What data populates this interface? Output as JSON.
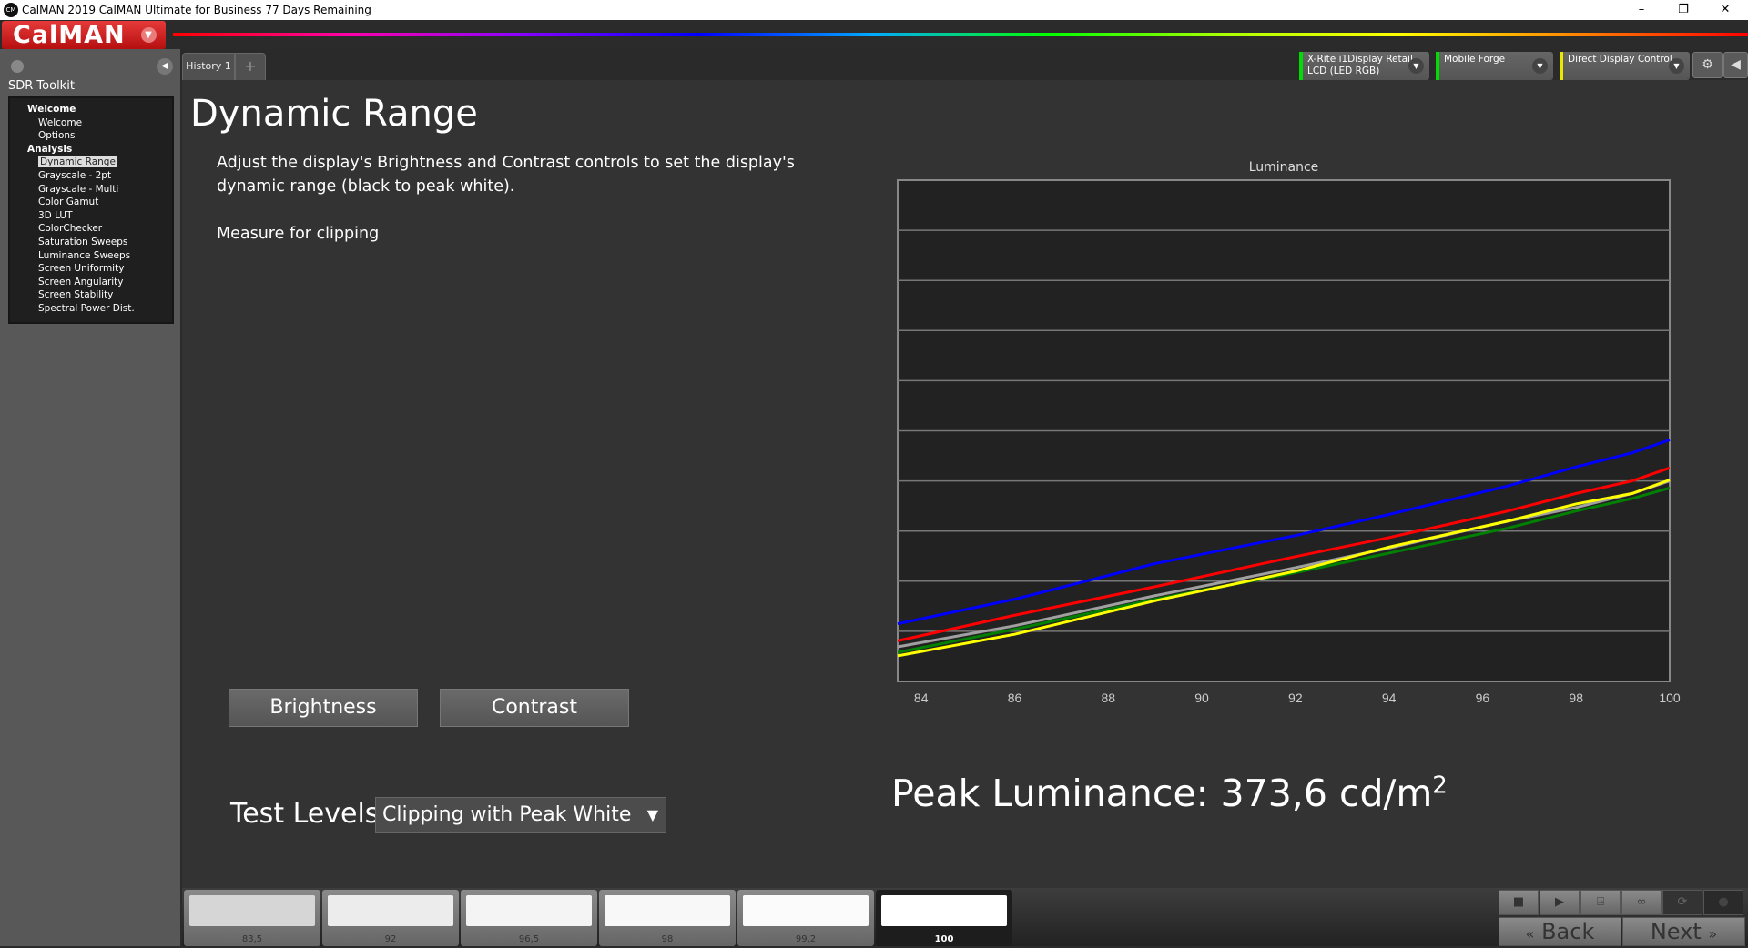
{
  "window": {
    "title": "CalMAN 2019 CalMAN Ultimate for Business 77 Days Remaining",
    "app_icon": "CM",
    "minimize": "–",
    "restore": "❐",
    "close": "✕"
  },
  "logo": "CalMAN",
  "sidebar": {
    "title": "SDR Toolkit",
    "groups": [
      {
        "label": "Welcome",
        "items": [
          "Welcome",
          "Options"
        ]
      },
      {
        "label": "Analysis",
        "items": [
          "Dynamic Range",
          "Grayscale - 2pt",
          "Grayscale - Multi",
          "Color Gamut",
          "3D LUT",
          "ColorChecker",
          "Saturation Sweeps",
          "Luminance Sweeps",
          "Screen Uniformity",
          "Screen Angularity",
          "Screen Stability",
          "Spectral Power Dist."
        ]
      }
    ],
    "selected": "Dynamic Range"
  },
  "tabs": {
    "items": [
      "History 1"
    ],
    "add": "+"
  },
  "devices": [
    {
      "line1": "X-Rite i1Display Retail",
      "line2": "LCD (LED RGB)",
      "color": "#00dd00"
    },
    {
      "line1": "Mobile Forge",
      "line2": "",
      "color": "#00dd00"
    },
    {
      "line1": "Direct Display Control",
      "line2": "",
      "color": "#e8e800"
    }
  ],
  "page": {
    "title": "Dynamic Range",
    "description": "Adjust the display's Brightness and Contrast controls to set the display's dynamic range (black to peak white).",
    "measure": "Measure for clipping",
    "brightness_label": "Brightness",
    "contrast_label": "Contrast",
    "test_levels_label": "Test Levels:",
    "test_levels_value": "Clipping with Peak White",
    "peak_label": "Peak Luminance: 373,6  cd/m",
    "peak_sup": "2"
  },
  "chart_data": {
    "type": "line",
    "title": "Luminance",
    "xlabel": "",
    "ylabel": "",
    "xlim": [
      83.5,
      100
    ],
    "ylim": [
      0,
      10
    ],
    "xticks": [
      "84",
      "86",
      "88",
      "90",
      "92",
      "94",
      "96",
      "98",
      "100"
    ],
    "grid": true,
    "x": [
      83.5,
      86,
      89,
      92,
      94,
      96.5,
      98,
      99.2,
      100
    ],
    "series": [
      {
        "color": "#0000ff",
        "values": [
          1.15,
          1.64,
          2.35,
          2.91,
          3.33,
          3.89,
          4.28,
          4.56,
          4.82
        ]
      },
      {
        "color": "#ff0000",
        "values": [
          0.81,
          1.32,
          1.89,
          2.49,
          2.87,
          3.39,
          3.75,
          4.0,
          4.26
        ]
      },
      {
        "color": "#008000",
        "values": [
          0.58,
          1.04,
          1.64,
          2.17,
          2.56,
          3.05,
          3.4,
          3.65,
          3.86
        ]
      },
      {
        "color": "#a0a0a0",
        "values": [
          0.69,
          1.11,
          1.71,
          2.27,
          2.66,
          3.19,
          3.47,
          3.75,
          4.0
        ]
      },
      {
        "color": "#ffff00",
        "values": [
          0.51,
          0.94,
          1.61,
          2.2,
          2.68,
          3.19,
          3.54,
          3.75,
          4.02
        ]
      }
    ]
  },
  "swatches": [
    {
      "label": "83,5",
      "color": "#d6d6d6"
    },
    {
      "label": "92",
      "color": "#ececec"
    },
    {
      "label": "96,5",
      "color": "#f4f4f4"
    },
    {
      "label": "98",
      "color": "#f8f8f8"
    },
    {
      "label": "99,2",
      "color": "#fbfbfb"
    },
    {
      "label": "100",
      "color": "#ffffff",
      "active": true
    }
  ],
  "transport": {
    "stop": "■",
    "play": "▶",
    "save": "⍈",
    "loop": "∞",
    "refresh": "⟳",
    "record": "●"
  },
  "nav": {
    "back": "Back",
    "next": "Next",
    "back_icon": "«",
    "next_icon": "»"
  }
}
